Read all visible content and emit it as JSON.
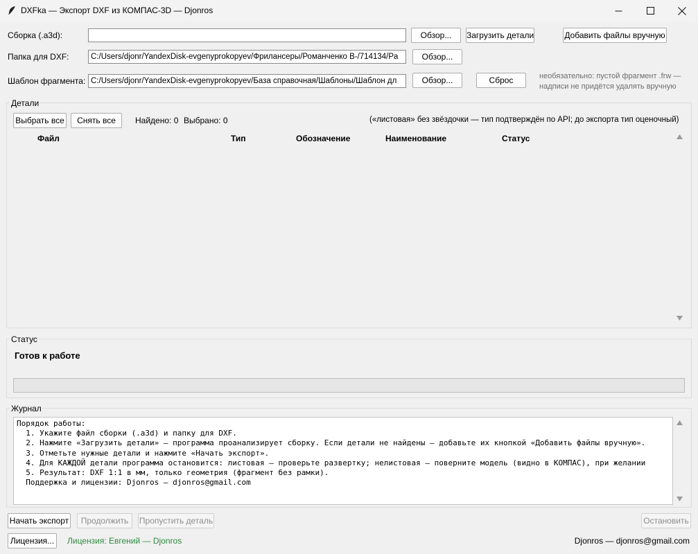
{
  "window": {
    "title": "DXFka — Экспорт DXF из КОМПАС-3D — Djonros"
  },
  "form": {
    "assembly_label": "Сборка (.a3d):",
    "assembly_value": "",
    "browse1": "Обзор...",
    "load_parts": "Загрузить детали",
    "add_files": "Добавить файлы вручную",
    "dxf_label": "Папка для DXF:",
    "dxf_value": "C:/Users/djonr/YandexDisk-evgenyprokopyev/Фрилансеры/Романченко В-/714134/Pa",
    "browse2": "Обзор...",
    "template_label": "Шаблон фрагмента:",
    "template_value": "C:/Users/djonr/YandexDisk-evgenyprokopyev/База справочная/Шаблоны/Шаблон дл",
    "browse3": "Обзор...",
    "reset": "Сброс",
    "template_hint_1": "необязательно: пустой фрагмент .frw —",
    "template_hint_2": "надписи не придётся удалять вручную"
  },
  "details": {
    "title": "Детали",
    "select_all": "Выбрать все",
    "deselect_all": "Снять все",
    "found": "Найдено: 0",
    "selected": "Выбрано: 0",
    "note": "(«листовая» без звёздочки — тип подтверждён по API; до экспорта тип оценочный)",
    "columns": [
      "Файл",
      "Тип",
      "Обозначение",
      "Наименование",
      "Статус"
    ],
    "rows": []
  },
  "status": {
    "title": "Статус",
    "text": "Готов к работе",
    "progress": 0
  },
  "journal": {
    "title": "Журнал",
    "lines": [
      "Порядок работы:",
      "  1. Укажите файл сборки (.a3d) и папку для DXF.",
      "  2. Нажмите «Загрузить детали» — программа проанализирует сборку. Если детали не найдены — добавьте их кнопкой «Добавить файлы вручную».",
      "  3. Отметьте нужные детали и нажмите «Начать экспорт».",
      "  4. Для КАЖДОЙ детали программа остановится: листовая — проверьте развертку; нелистовая — поверните модель (видно в КОМПАС), при желании",
      "  5. Результат: DXF 1:1 в мм, только геометрия (фрагмент без рамки).",
      "  Поддержка и лицензии: Djonros — djonros@gmail.com"
    ]
  },
  "actions": {
    "start": "Начать экспорт",
    "continue": "Продолжить",
    "skip": "Пропустить деталь",
    "stop": "Остановить"
  },
  "footer": {
    "license_button": "Лицензия...",
    "license_text": "Лицензия: Евгений — Djonros",
    "license_color": "#2e8b3e",
    "contact": "Djonros — djonros@gmail.com"
  }
}
